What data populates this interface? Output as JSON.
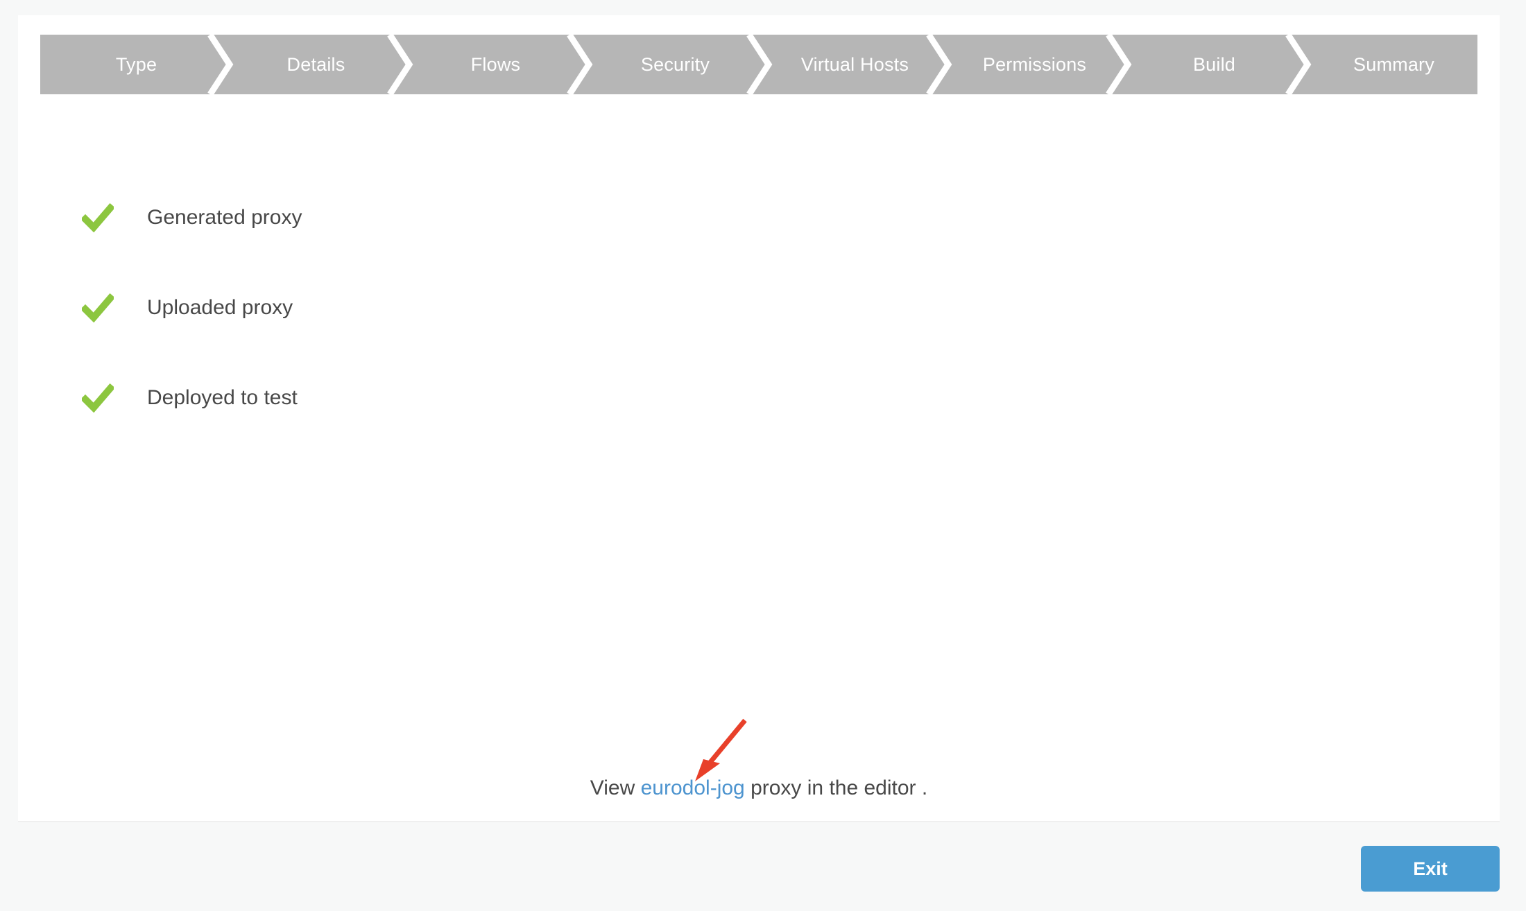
{
  "theme": {
    "page_background": "#f7f8f8",
    "panel_background": "#ffffff",
    "step_bar_color": "#b6b6b6",
    "step_text_color": "#ffffff",
    "check_green": "#8cc63f",
    "body_text_color": "#484848",
    "link_blue": "#4d94cf",
    "button_blue": "#4a9cd2",
    "annotation_red": "#e8402a"
  },
  "wizard": {
    "steps": [
      {
        "label": "Type",
        "state": "complete"
      },
      {
        "label": "Details",
        "state": "complete"
      },
      {
        "label": "Flows",
        "state": "complete"
      },
      {
        "label": "Security",
        "state": "complete"
      },
      {
        "label": "Virtual Hosts",
        "state": "complete"
      },
      {
        "label": "Permissions",
        "state": "complete"
      },
      {
        "label": "Build",
        "state": "complete"
      },
      {
        "label": "Summary",
        "state": "current"
      }
    ]
  },
  "status": {
    "items": [
      {
        "label": "Generated proxy",
        "icon": "check-icon",
        "state": "done"
      },
      {
        "label": "Uploaded proxy",
        "icon": "check-icon",
        "state": "done"
      },
      {
        "label": "Deployed to test",
        "icon": "check-icon",
        "state": "done"
      }
    ]
  },
  "editor_line": {
    "prefix": "View ",
    "link_text": "eurodol-jog",
    "suffix": " proxy in the editor ."
  },
  "annotation": {
    "type": "arrow",
    "color": "#e8402a",
    "points_to": "eurodol-jog"
  },
  "footer": {
    "exit_label": "Exit"
  }
}
